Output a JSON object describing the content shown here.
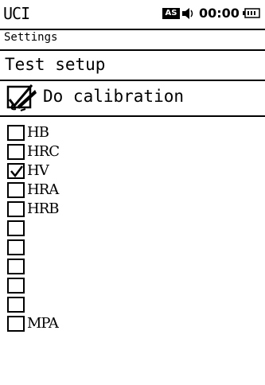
{
  "status_bar": {
    "app_title": "UCI",
    "badge": "AS",
    "time": "00:00"
  },
  "breadcrumb": "Settings",
  "header": "Test setup",
  "calibration": {
    "label": "Do calibration"
  },
  "scales": [
    {
      "label": "HB",
      "checked": false
    },
    {
      "label": "HRC",
      "checked": false
    },
    {
      "label": "HV",
      "checked": true
    },
    {
      "label": "HRA",
      "checked": false
    },
    {
      "label": "HRB",
      "checked": false
    },
    {
      "label": "",
      "checked": false
    },
    {
      "label": "",
      "checked": false
    },
    {
      "label": "",
      "checked": false
    },
    {
      "label": "",
      "checked": false
    },
    {
      "label": "",
      "checked": false
    },
    {
      "label": "MPA",
      "checked": false
    }
  ]
}
